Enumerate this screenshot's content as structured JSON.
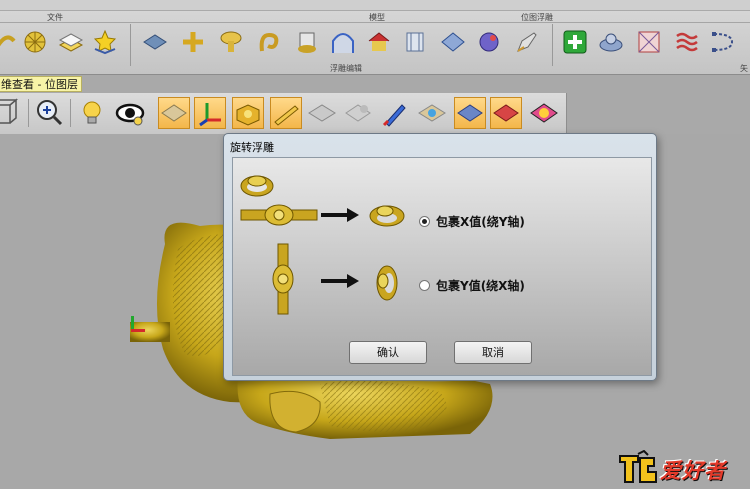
{
  "ribbon": {
    "groups": {
      "file": "文件",
      "model": "模型",
      "bitmap_relief": "位图浮雕",
      "relief_edit": "浮雕编辑",
      "truncated": "矢"
    }
  },
  "view_tab": {
    "label": "维查看 - 位图层"
  },
  "dialog": {
    "title": "旋转浮雕",
    "options": [
      {
        "label": "包裹X值(绕Y轴)",
        "selected": true
      },
      {
        "label": "包裹Y值(绕X轴)",
        "selected": false
      }
    ],
    "ok_label": "确认",
    "cancel_label": "取消"
  },
  "watermark": {
    "text": "爱好者"
  },
  "colors": {
    "relief_gold": "#d4b41c",
    "highlight": "#f3b64a",
    "dialog_frame": "#c6d1db"
  }
}
